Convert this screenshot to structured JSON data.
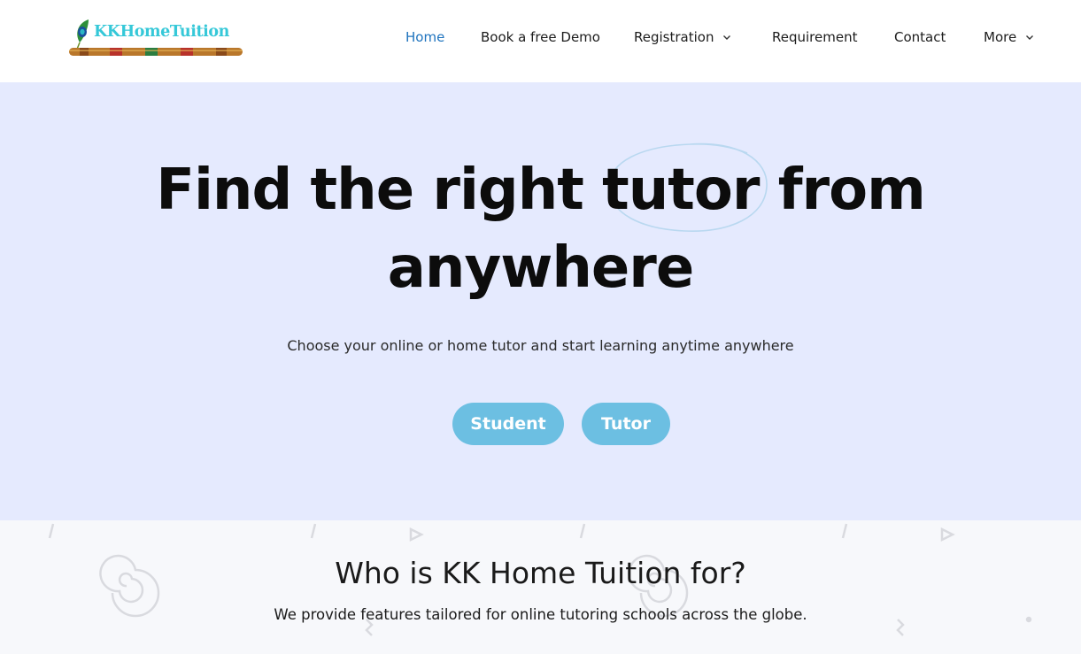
{
  "brand": {
    "name": "KKHomeTuition"
  },
  "nav": {
    "items": [
      {
        "label": "Home",
        "active": true,
        "dropdown": false
      },
      {
        "label": "Book a free Demo",
        "active": false,
        "dropdown": false
      },
      {
        "label": "Registration",
        "active": false,
        "dropdown": true
      },
      {
        "label": "Requirement",
        "active": false,
        "dropdown": false
      },
      {
        "label": "Contact",
        "active": false,
        "dropdown": false
      },
      {
        "label": "More",
        "active": false,
        "dropdown": true
      }
    ]
  },
  "hero": {
    "title_line1": "Find the right tutor from",
    "title_line2": "anywhere",
    "subtitle": "Choose your online or home tutor and start learning anytime anywhere",
    "student_button": "Student",
    "tutor_button": "Tutor"
  },
  "section": {
    "title": "Who is KK Home Tuition for?",
    "subtitle": "We provide features tailored for online tutoring schools across the globe."
  },
  "colors": {
    "hero_bg": "#e5eafe",
    "accent": "#6cbfe2",
    "nav_active": "#1e73be",
    "logo_text": "#35c8d8"
  },
  "icons": {
    "logo": "flute-peacock-feather-icon",
    "dropdown": "chevron-down-icon"
  }
}
